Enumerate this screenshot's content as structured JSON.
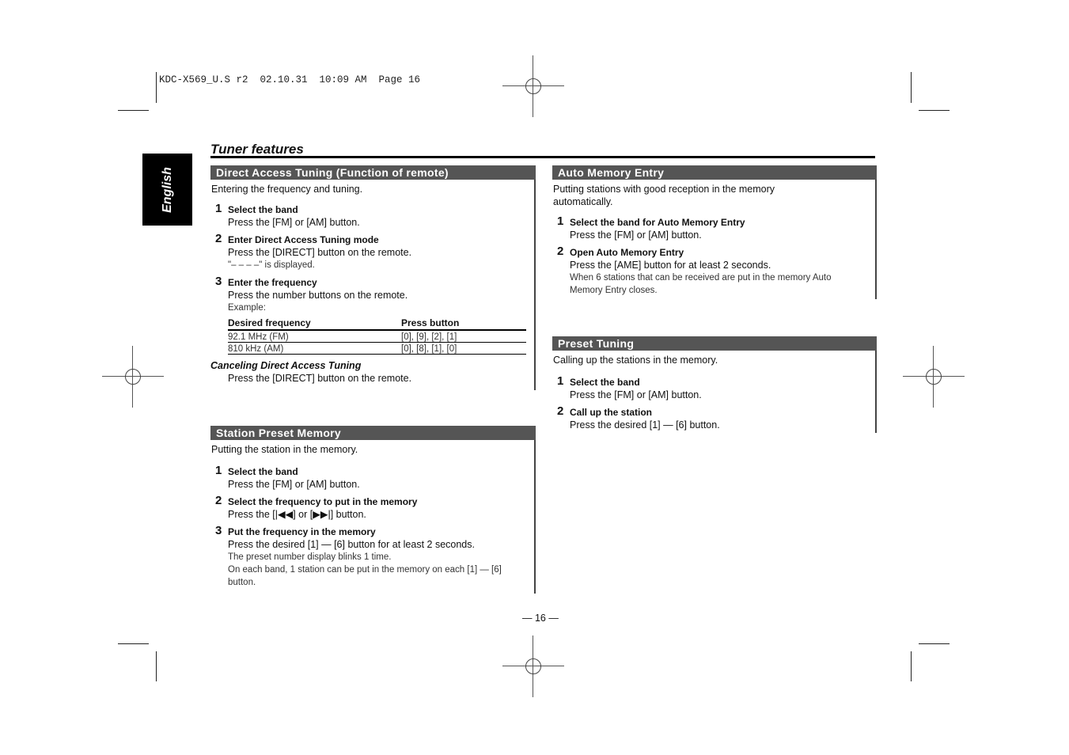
{
  "slug": "KDC-X569_U.S r2  02.10.31  10:09 AM  Page 16",
  "language_tab": "English",
  "page_title": "Tuner features",
  "page_number": "— 16 —",
  "sections": {
    "direct_access": {
      "heading": "Direct Access Tuning (Function of remote)",
      "intro": "Entering the frequency and tuning.",
      "steps": [
        {
          "num": "1",
          "title": "Select the band",
          "desc": "Press the [FM] or [AM] button."
        },
        {
          "num": "2",
          "title": "Enter Direct Access Tuning mode",
          "desc": "Press the [DIRECT] button on the remote.",
          "note": "\"– – – –\" is displayed."
        },
        {
          "num": "3",
          "title": "Enter the frequency",
          "desc": "Press the number buttons on the remote.",
          "note": "Example:"
        }
      ],
      "table": {
        "headers": [
          "Desired frequency",
          "Press button"
        ],
        "rows": [
          [
            "92.1 MHz (FM)",
            "[0], [9], [2], [1]"
          ],
          [
            "810 kHz (AM)",
            "[0], [8], [1], [0]"
          ]
        ]
      },
      "cancel_title": "Canceling Direct Access Tuning",
      "cancel_desc": "Press the [DIRECT] button on the remote."
    },
    "station_preset": {
      "heading": "Station Preset Memory",
      "intro": "Putting the station in the memory.",
      "steps": [
        {
          "num": "1",
          "title": "Select the band",
          "desc": "Press the [FM] or [AM] button."
        },
        {
          "num": "2",
          "title": "Select the frequency to put in the memory",
          "desc": "Press the [|◀◀] or [▶▶|] button."
        },
        {
          "num": "3",
          "title": "Put the frequency in the memory",
          "desc": "Press the desired [1] — [6] button for at least 2 seconds.",
          "note": "The preset number display blinks 1 time.",
          "note2": "On each band, 1 station can be put in the memory on each [1] — [6] button."
        }
      ]
    },
    "auto_memory": {
      "heading": "Auto Memory Entry",
      "intro": "Putting stations with good reception in the memory automatically.",
      "steps": [
        {
          "num": "1",
          "title": "Select the band for Auto Memory Entry",
          "desc": "Press the [FM] or [AM] button."
        },
        {
          "num": "2",
          "title": "Open Auto Memory Entry",
          "desc": "Press the [AME] button for at least 2 seconds.",
          "note": "When 6 stations that can be received are put in the memory Auto Memory Entry closes."
        }
      ]
    },
    "preset_tuning": {
      "heading": "Preset Tuning",
      "intro": "Calling up the stations in the memory.",
      "steps": [
        {
          "num": "1",
          "title": "Select the band",
          "desc": "Press the [FM] or [AM] button."
        },
        {
          "num": "2",
          "title": "Call up the station",
          "desc": "Press the desired [1] — [6] button."
        }
      ]
    }
  }
}
